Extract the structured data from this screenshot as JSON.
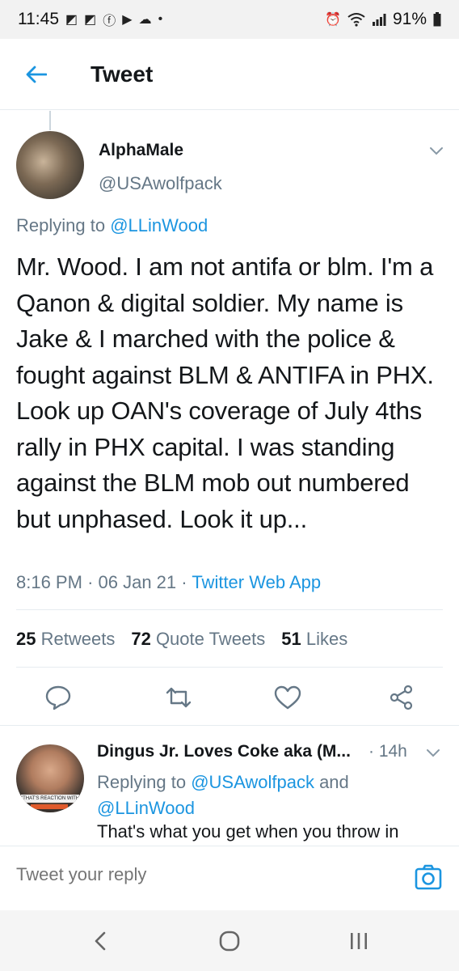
{
  "status_bar": {
    "time": "11:45",
    "battery": "91%",
    "icons": [
      "app-notification-icon",
      "app-notification-icon",
      "facebook-icon",
      "youtube-icon",
      "cloud-icon",
      "dot-icon",
      "alarm-icon",
      "wifi-icon",
      "signal-icon",
      "battery-icon"
    ]
  },
  "header": {
    "title": "Tweet",
    "back_icon": "back-arrow-icon"
  },
  "tweet": {
    "author_name": "AlphaMale",
    "author_handle": "@USAwolfpack",
    "replying_prefix": "Replying to ",
    "replying_mention": "@LLinWood",
    "text": "Mr. Wood. I am not antifa or blm. I'm a Qanon & digital soldier. My name is Jake & I marched with the police & fought against BLM & ANTIFA in PHX. Look up OAN's coverage of July 4ths rally in PHX capital. I was standing against the BLM mob out numbered but unphased. Look it up...",
    "time": "8:16 PM",
    "date": "06 Jan 21",
    "app": "Twitter Web App",
    "stats": {
      "retweets_count": "25",
      "retweets_label": "Retweets",
      "quotes_count": "72",
      "quotes_label": "Quote Tweets",
      "likes_count": "51",
      "likes_label": "Likes"
    },
    "actions": [
      "reply-icon",
      "retweet-icon",
      "like-icon",
      "share-icon"
    ]
  },
  "reply": {
    "author_name": "Dingus Jr. Loves Coke aka (M...",
    "time": "14h",
    "replying_prefix": "Replying to ",
    "mention_1": "@USAwolfpack",
    "and": " and ",
    "mention_2": "@LLinWood",
    "text": "That's what you get when you throw in",
    "avatar_caption": "\"THAT'S REACTION WITH DONALD\""
  },
  "compose": {
    "placeholder": "Tweet your reply",
    "icon": "camera-icon"
  },
  "nav": [
    "recent-apps-icon",
    "home-icon",
    "back-icon"
  ],
  "colors": {
    "accent": "#1b95e0",
    "secondary_text": "#657786",
    "primary_text": "#14171a",
    "divider": "#e6ecf0"
  }
}
